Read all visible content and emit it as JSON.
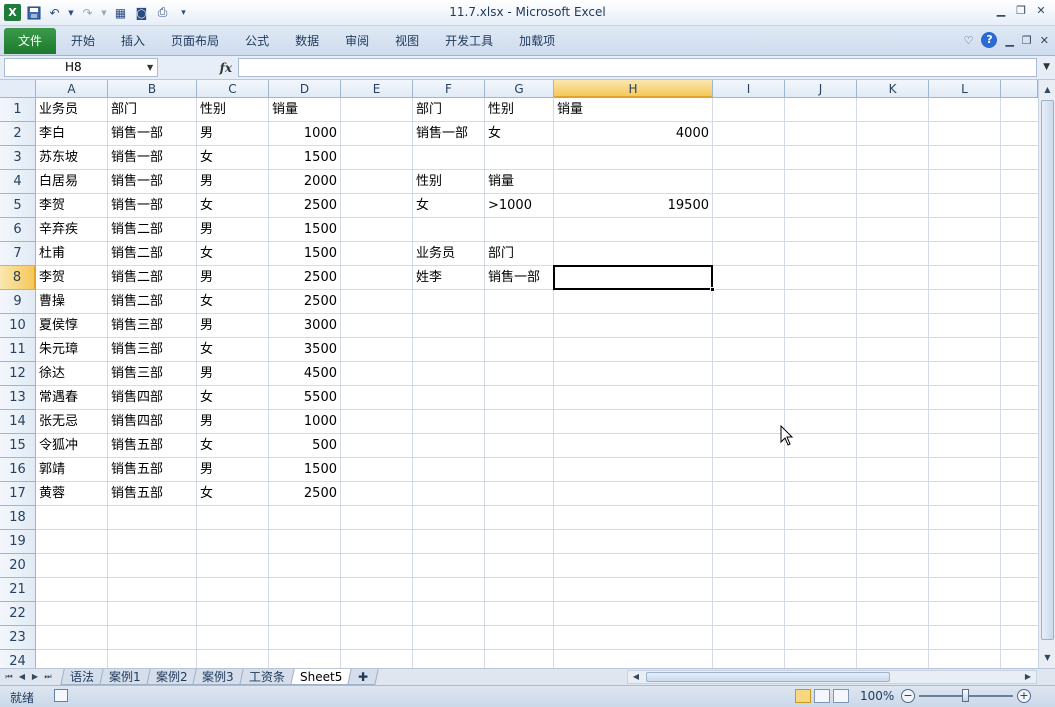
{
  "window": {
    "title": "11.7.xlsx  -  Microsoft Excel",
    "controls": [
      "minimize-icon",
      "restore-icon",
      "close-icon"
    ]
  },
  "quick_access": [
    "excel-logo-icon",
    "save-icon",
    "undo-icon",
    "redo-icon",
    "form-icon",
    "camera-icon",
    "print-preview-icon",
    "customize-icon"
  ],
  "ribbon": {
    "file": "文件",
    "tabs": [
      "开始",
      "插入",
      "页面布局",
      "公式",
      "数据",
      "审阅",
      "视图",
      "开发工具",
      "加载项"
    ]
  },
  "formula_bar": {
    "name_box": "H8",
    "fx": "fx",
    "formula": ""
  },
  "sheet": {
    "columns": [
      "A",
      "B",
      "C",
      "D",
      "E",
      "F",
      "G",
      "H",
      "I",
      "J",
      "K",
      "L"
    ],
    "active_column": "H",
    "rows": [
      "1",
      "2",
      "3",
      "4",
      "5",
      "6",
      "7",
      "8",
      "9",
      "10",
      "11",
      "12",
      "13",
      "14",
      "15",
      "16",
      "17",
      "18",
      "19",
      "20",
      "21",
      "22",
      "23",
      "24"
    ],
    "active_row": "8",
    "active_cell": "H8",
    "cells": [
      {
        "ref": "A1",
        "text": "业务员"
      },
      {
        "ref": "B1",
        "text": "部门"
      },
      {
        "ref": "C1",
        "text": "性别"
      },
      {
        "ref": "D1",
        "text": "销量"
      },
      {
        "ref": "A2",
        "text": "李白"
      },
      {
        "ref": "B2",
        "text": "销售一部"
      },
      {
        "ref": "C2",
        "text": "男"
      },
      {
        "ref": "D2",
        "text": "1000",
        "num": true
      },
      {
        "ref": "A3",
        "text": "苏东坡"
      },
      {
        "ref": "B3",
        "text": "销售一部"
      },
      {
        "ref": "C3",
        "text": "女"
      },
      {
        "ref": "D3",
        "text": "1500",
        "num": true
      },
      {
        "ref": "A4",
        "text": "白居易"
      },
      {
        "ref": "B4",
        "text": "销售一部"
      },
      {
        "ref": "C4",
        "text": "男"
      },
      {
        "ref": "D4",
        "text": "2000",
        "num": true
      },
      {
        "ref": "A5",
        "text": "李贺"
      },
      {
        "ref": "B5",
        "text": "销售一部"
      },
      {
        "ref": "C5",
        "text": "女"
      },
      {
        "ref": "D5",
        "text": "2500",
        "num": true
      },
      {
        "ref": "A6",
        "text": "辛弃疾"
      },
      {
        "ref": "B6",
        "text": "销售二部"
      },
      {
        "ref": "C6",
        "text": "男"
      },
      {
        "ref": "D6",
        "text": "1500",
        "num": true
      },
      {
        "ref": "A7",
        "text": "杜甫"
      },
      {
        "ref": "B7",
        "text": "销售二部"
      },
      {
        "ref": "C7",
        "text": "女"
      },
      {
        "ref": "D7",
        "text": "1500",
        "num": true
      },
      {
        "ref": "A8",
        "text": "李贺"
      },
      {
        "ref": "B8",
        "text": "销售二部"
      },
      {
        "ref": "C8",
        "text": "男"
      },
      {
        "ref": "D8",
        "text": "2500",
        "num": true
      },
      {
        "ref": "A9",
        "text": "曹操"
      },
      {
        "ref": "B9",
        "text": "销售二部"
      },
      {
        "ref": "C9",
        "text": "女"
      },
      {
        "ref": "D9",
        "text": "2500",
        "num": true
      },
      {
        "ref": "A10",
        "text": "夏侯惇"
      },
      {
        "ref": "B10",
        "text": "销售三部"
      },
      {
        "ref": "C10",
        "text": "男"
      },
      {
        "ref": "D10",
        "text": "3000",
        "num": true
      },
      {
        "ref": "A11",
        "text": "朱元璋"
      },
      {
        "ref": "B11",
        "text": "销售三部"
      },
      {
        "ref": "C11",
        "text": "女"
      },
      {
        "ref": "D11",
        "text": "3500",
        "num": true
      },
      {
        "ref": "A12",
        "text": "徐达"
      },
      {
        "ref": "B12",
        "text": "销售三部"
      },
      {
        "ref": "C12",
        "text": "男"
      },
      {
        "ref": "D12",
        "text": "4500",
        "num": true
      },
      {
        "ref": "A13",
        "text": "常遇春"
      },
      {
        "ref": "B13",
        "text": "销售四部"
      },
      {
        "ref": "C13",
        "text": "女"
      },
      {
        "ref": "D13",
        "text": "5500",
        "num": true
      },
      {
        "ref": "A14",
        "text": "张无忌"
      },
      {
        "ref": "B14",
        "text": "销售四部"
      },
      {
        "ref": "C14",
        "text": "男"
      },
      {
        "ref": "D14",
        "text": "1000",
        "num": true
      },
      {
        "ref": "A15",
        "text": "令狐冲"
      },
      {
        "ref": "B15",
        "text": "销售五部"
      },
      {
        "ref": "C15",
        "text": "女"
      },
      {
        "ref": "D15",
        "text": "500",
        "num": true
      },
      {
        "ref": "A16",
        "text": "郭靖"
      },
      {
        "ref": "B16",
        "text": "销售五部"
      },
      {
        "ref": "C16",
        "text": "男"
      },
      {
        "ref": "D16",
        "text": "1500",
        "num": true
      },
      {
        "ref": "A17",
        "text": "黄蓉"
      },
      {
        "ref": "B17",
        "text": "销售五部"
      },
      {
        "ref": "C17",
        "text": "女"
      },
      {
        "ref": "D17",
        "text": "2500",
        "num": true
      },
      {
        "ref": "F1",
        "text": "部门"
      },
      {
        "ref": "G1",
        "text": "性别"
      },
      {
        "ref": "H1",
        "text": "销量"
      },
      {
        "ref": "F2",
        "text": "销售一部"
      },
      {
        "ref": "G2",
        "text": "女"
      },
      {
        "ref": "H2",
        "text": "4000",
        "num": true
      },
      {
        "ref": "F4",
        "text": "性别"
      },
      {
        "ref": "G4",
        "text": "销量"
      },
      {
        "ref": "F5",
        "text": "女"
      },
      {
        "ref": "G5",
        "text": ">1000"
      },
      {
        "ref": "H5",
        "text": "19500",
        "num": true
      },
      {
        "ref": "F7",
        "text": "业务员"
      },
      {
        "ref": "G7",
        "text": "部门"
      },
      {
        "ref": "F8",
        "text": "姓李"
      },
      {
        "ref": "G8",
        "text": "销售一部"
      }
    ]
  },
  "sheet_tabs": {
    "tabs": [
      "语法",
      "案例1",
      "案例2",
      "案例3",
      "工资条",
      "Sheet5"
    ],
    "active": "Sheet5"
  },
  "status_bar": {
    "ready": "就绪",
    "zoom": "100%",
    "zoom_level_percent": 100
  },
  "colors": {
    "file_tab": "#1e7a2e",
    "active_header": "#f5c85a",
    "gridline": "#d4dbe5"
  }
}
